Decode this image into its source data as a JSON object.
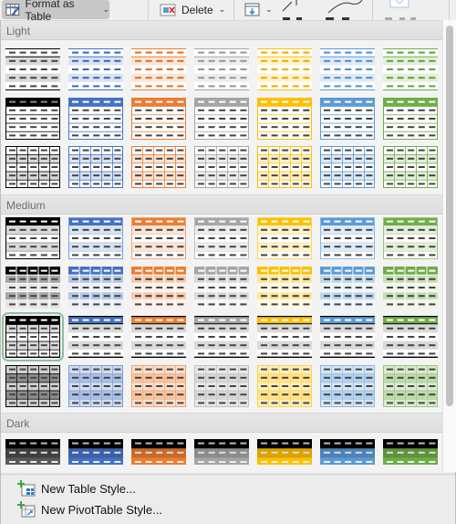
{
  "ribbon": {
    "format_as_table_label": "Format as Table",
    "delete_label": "Delete",
    "format_as_table_icon": "table-format-icon",
    "delete_icon": "delete-cells-icon",
    "fill_icon": "fill-down-icon"
  },
  "sections": [
    {
      "label": "Light",
      "rows": 3
    },
    {
      "label": "Medium",
      "rows": 4
    },
    {
      "label": "Dark",
      "rows": 1
    }
  ],
  "colors": {
    "black": "#000000",
    "blue": "#4472c4",
    "orange": "#ed7d31",
    "gray": "#a5a5a5",
    "gold": "#ffc000",
    "lightblue": "#5b9bd5",
    "green": "#70ad47"
  },
  "style_colors": [
    "black",
    "blue",
    "orange",
    "gray",
    "gold",
    "lightblue",
    "green"
  ],
  "selected_style": "Medium 15",
  "footer": {
    "new_table_style": "New Table Style...",
    "new_pivot_style": "New PivotTable Style..."
  }
}
